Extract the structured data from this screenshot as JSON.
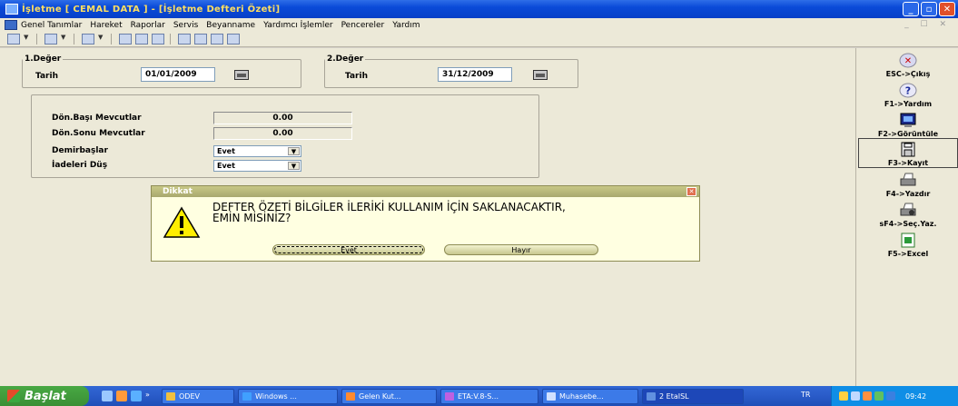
{
  "window": {
    "title": "İşletme [ CEMAL DATA ] - [İşletme Defteri Özeti]",
    "controls": [
      "minimize",
      "maximize",
      "close"
    ]
  },
  "menu": {
    "items": [
      {
        "label": "Genel Tanımlar"
      },
      {
        "label": "Hareket"
      },
      {
        "label": "Raporlar"
      },
      {
        "label": "Servis"
      },
      {
        "label": "Beyanname"
      },
      {
        "label": "Yardımcı İşlemler"
      },
      {
        "label": "Pencereler"
      },
      {
        "label": "Yardım"
      }
    ],
    "child_controls": "_ ☐ ✕"
  },
  "form": {
    "deger1": {
      "legend": "1.Değer",
      "label": "Tarih",
      "value": "01/01/2009"
    },
    "deger2": {
      "legend": "2.Değer",
      "label": "Tarih",
      "value": "31/12/2009"
    },
    "donbasi": {
      "label": "Dön.Başı Mevcutlar",
      "value": "0.00"
    },
    "donsonu": {
      "label": "Dön.Sonu Mevcutlar",
      "value": "0.00"
    },
    "demirbaslar": {
      "label": "Demirbaşlar",
      "value": "Evet"
    },
    "iadeleri": {
      "label": "İadeleri Düş",
      "value": "Evet"
    }
  },
  "dialog": {
    "title": "Dikkat",
    "message": "DEFTER ÖZETİ BİLGİLER İLERİKİ KULLANIM İÇİN SAKLANACAKTIR,\nEMİN MİSİNİZ?",
    "yes": "Evet",
    "no": "Hayır"
  },
  "right_panel": {
    "buttons": [
      {
        "label": "ESC->Çıkış",
        "icon": "exit-icon"
      },
      {
        "label": "F1->Yardım",
        "icon": "help-icon"
      },
      {
        "label": "F2->Görüntüle",
        "icon": "monitor-icon"
      },
      {
        "label": "F3->Kayıt",
        "icon": "save-icon"
      },
      {
        "label": "F4->Yazdır",
        "icon": "print-icon"
      },
      {
        "label": "sF4->Seç.Yaz.",
        "icon": "print-select-icon"
      },
      {
        "label": "F5->Excel",
        "icon": "excel-icon"
      }
    ]
  },
  "taskbar": {
    "start": "Başlat",
    "tasks": [
      {
        "label": "ODEV"
      },
      {
        "label": "Windows ..."
      },
      {
        "label": "Gelen Kut..."
      },
      {
        "label": "ETA:V.8-S..."
      },
      {
        "label": "Muhasebe..."
      },
      {
        "label": "2 EtaISL"
      }
    ],
    "lang": "TR",
    "clock": "09:42"
  }
}
